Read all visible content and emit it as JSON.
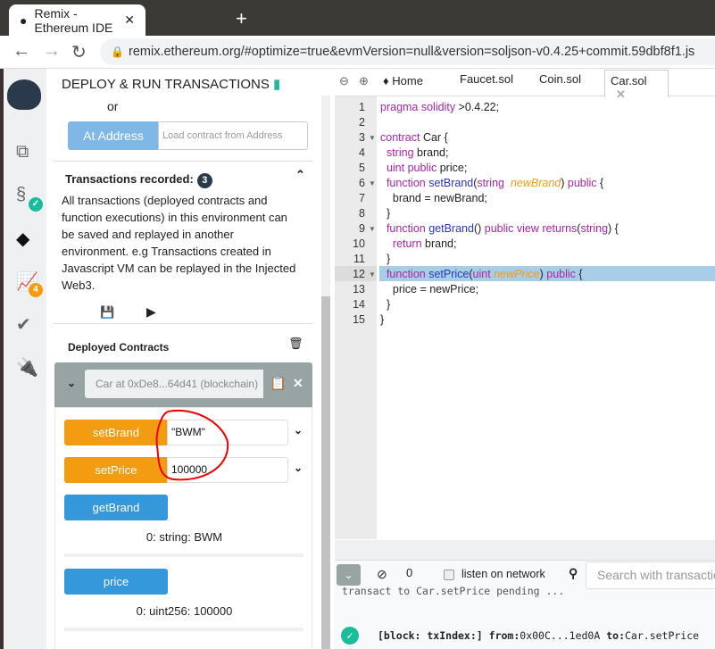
{
  "browser": {
    "tab_title": "Remix - Ethereum IDE",
    "url": "remix.ethereum.org/#optimize=true&evmVersion=null&version=soljson-v0.4.25+commit.59dbf8f1.js"
  },
  "iconbar": {
    "badges": {
      "compile": "✓",
      "analysis": "4"
    }
  },
  "panel": {
    "title": "DEPLOY & RUN TRANSACTIONS",
    "or": "or",
    "at_address": "At Address",
    "load_placeholder": "Load contract from Address",
    "tx_recorded": "Transactions recorded:",
    "tx_count": "3",
    "tx_desc": "All transactions (deployed contracts and function executions) in this environment can be saved and replayed in another environment. e.g Transactions created in Javascript VM can be replayed in the Injected Web3.",
    "deployed": "Deployed Contracts",
    "instance": "Car at 0xDe8...64d41 (blockchain)",
    "functions": [
      {
        "name": "setBrand",
        "value": "\"BWM\""
      },
      {
        "name": "setPrice",
        "value": "100000"
      },
      {
        "name": "getBrand",
        "output": "0: string: BWM"
      },
      {
        "name": "price",
        "output": "0: uint256: 100000"
      }
    ]
  },
  "editor": {
    "tabs": [
      "Home",
      "Faucet.sol",
      "Coin.sol",
      "Car.sol"
    ],
    "active_tab": "Car.sol",
    "highlighted_line": 12
  },
  "terminal": {
    "count": "0",
    "listen": "listen on network",
    "search_placeholder": "Search with transaction hash or address",
    "pending": "transact to Car.setPrice pending ...",
    "log_block": "[block: txIndex:]",
    "log_from_label": "from:",
    "log_from": "0x00C...1ed0A",
    "log_to_label": "to:",
    "log_to": "Car.setPrice"
  },
  "colors": {
    "orange": "#f39c12",
    "blue": "#3498db",
    "highlight": "#a8cde6",
    "success": "#1abc9c"
  }
}
